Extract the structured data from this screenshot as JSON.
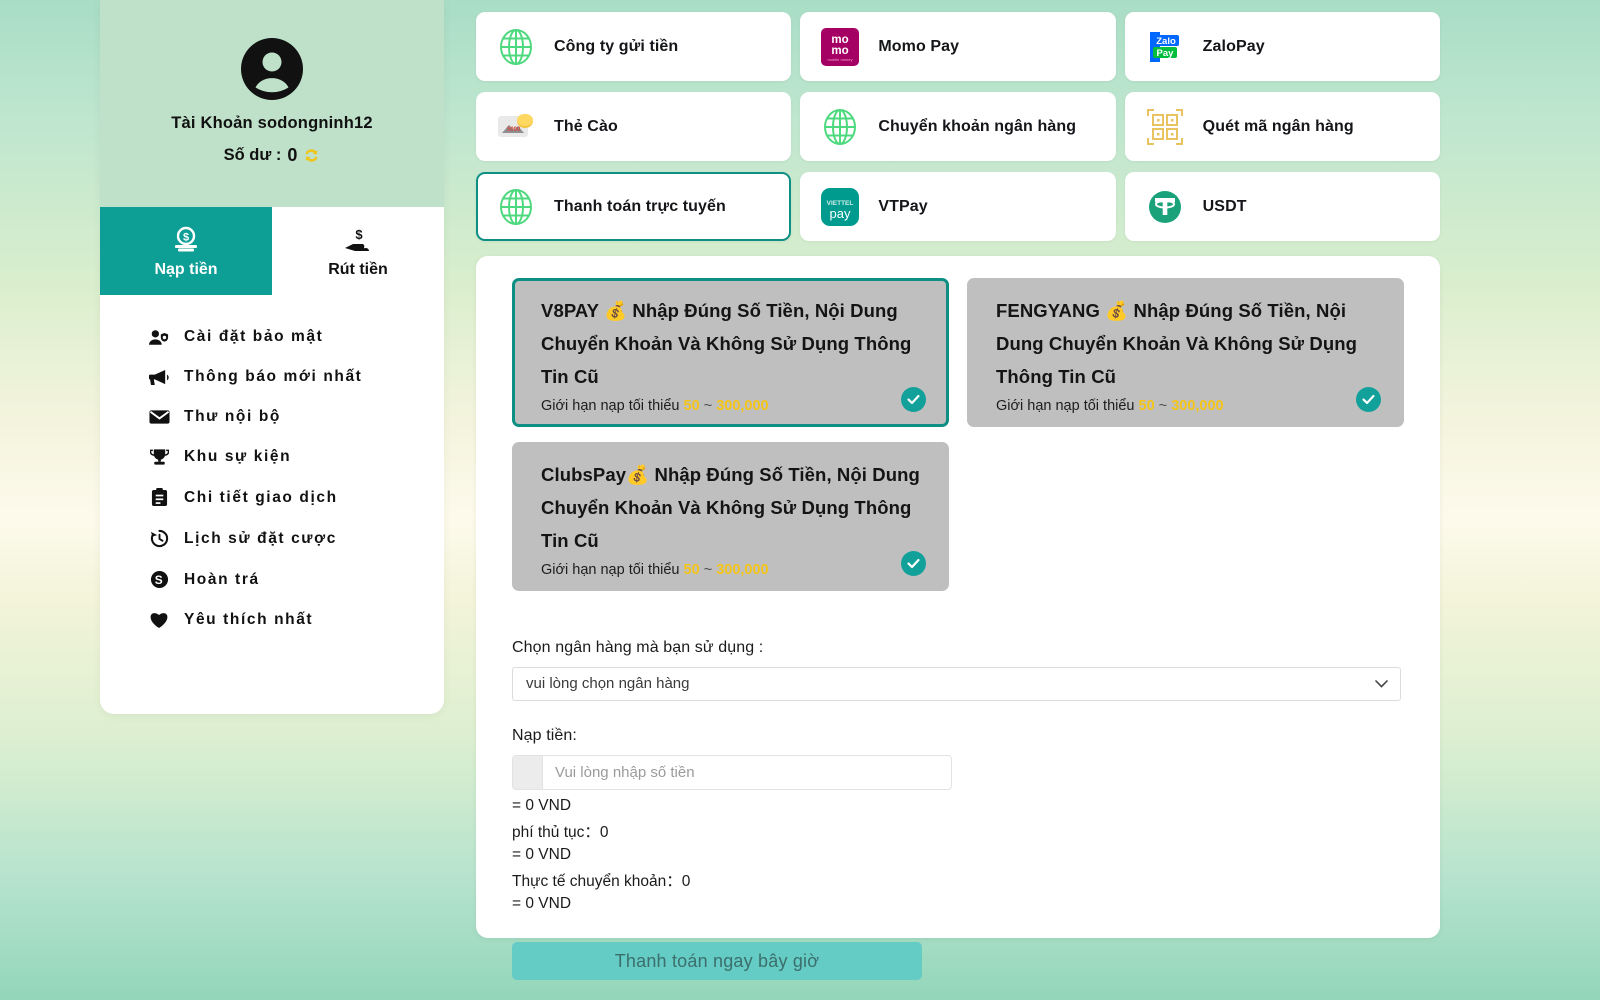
{
  "theme": {
    "accent_teal": "#0d9e96",
    "accent_border": "#0d8f84",
    "profile_bg": "#bfe1c9",
    "provider_bg": "#bfbfbf",
    "amount_gold": "#f5c518",
    "pay_button": "#64cbc5"
  },
  "sidebar": {
    "avatar_icon": "user-avatar-icon",
    "account_label": "Tài Khoản sodongninh12",
    "balance_label": "Số dư :",
    "balance_value": "0",
    "refresh_icon": "refresh-icon",
    "tabs": [
      {
        "label": "Nạp tiền",
        "icon": "deposit-coin-icon",
        "active": true
      },
      {
        "label": "Rút tiền",
        "icon": "withdraw-hand-icon",
        "active": false
      }
    ],
    "menu": [
      {
        "label": "Cài đặt bảo mật",
        "icon": "user-shield-icon"
      },
      {
        "label": "Thông báo mới nhất",
        "icon": "megaphone-icon"
      },
      {
        "label": "Thư nội bộ",
        "icon": "envelope-icon"
      },
      {
        "label": "Khu sự kiện",
        "icon": "trophy-icon"
      },
      {
        "label": "Chi tiết giao dịch",
        "icon": "clipboard-icon"
      },
      {
        "label": "Lịch sử đặt cược",
        "icon": "history-clock-icon"
      },
      {
        "label": "Hoàn trá",
        "icon": "dollar-circle-icon"
      },
      {
        "label": "Yêu thích nhất",
        "icon": "heart-icon"
      }
    ]
  },
  "methods": [
    {
      "label": "Công ty gửi tiền",
      "icon": "globe-icon",
      "selected": false
    },
    {
      "label": "Momo Pay",
      "icon": "momo-logo-icon",
      "selected": false
    },
    {
      "label": "ZaloPay",
      "icon": "zalopay-logo-icon",
      "selected": false
    },
    {
      "label": "Thẻ Cào",
      "icon": "scratch-card-icon",
      "selected": false
    },
    {
      "label": "Chuyển khoản ngân hàng",
      "icon": "globe-icon",
      "selected": false
    },
    {
      "label": "Quét mã ngân hàng",
      "icon": "qr-code-icon",
      "selected": false
    },
    {
      "label": "Thanh toán trực tuyến",
      "icon": "globe-icon",
      "selected": true
    },
    {
      "label": "VTPay",
      "icon": "viettelpay-logo-icon",
      "selected": false
    },
    {
      "label": "USDT",
      "icon": "tether-logo-icon",
      "selected": false
    }
  ],
  "providers": [
    {
      "title": "V8PAY 💰 Nhập Đúng Số Tiền, Nội Dung Chuyển Khoản Và Không Sử Dụng Thông Tin Cũ",
      "limit_prefix": "Giới hạn nạp tối thiểu",
      "limit_min": "50",
      "limit_sep": "~",
      "limit_max": "300,000",
      "selected": true,
      "check_icon": "check-circle-icon"
    },
    {
      "title": "FENGYANG 💰 Nhập Đúng Số Tiền, Nội Dung Chuyển Khoản Và Không Sử Dụng Thông Tin Cũ",
      "limit_prefix": "Giới hạn nạp tối thiểu",
      "limit_min": "50",
      "limit_sep": "~",
      "limit_max": "300,000",
      "selected": false,
      "check_icon": "check-circle-icon"
    },
    {
      "title": "ClubsPay💰 Nhập Đúng Số Tiền, Nội Dung Chuyển Khoản Và Không Sử Dụng Thông Tin Cũ",
      "limit_prefix": "Giới hạn nạp tối thiểu",
      "limit_min": "50",
      "limit_sep": "~",
      "limit_max": "300,000",
      "selected": false,
      "check_icon": "check-circle-icon"
    }
  ],
  "form": {
    "bank_label": "Chọn ngân hàng mà bạn sử dụng :",
    "bank_selected": "vui lòng chọn ngân hàng",
    "bank_caret_icon": "chevron-down-icon",
    "amount_label": "Nạp tiền:",
    "amount_placeholder": "Vui lòng nhập số tiền",
    "amount_value": "",
    "amount_vnd": "= 0 VND",
    "fee_label": "phí thủ tục：",
    "fee_value": "0",
    "fee_vnd": "= 0 VND",
    "actual_label": "Thực tế chuyển khoản：",
    "actual_value": "0",
    "actual_vnd": "= 0 VND",
    "submit_label": "Thanh toán ngay bây giờ"
  }
}
